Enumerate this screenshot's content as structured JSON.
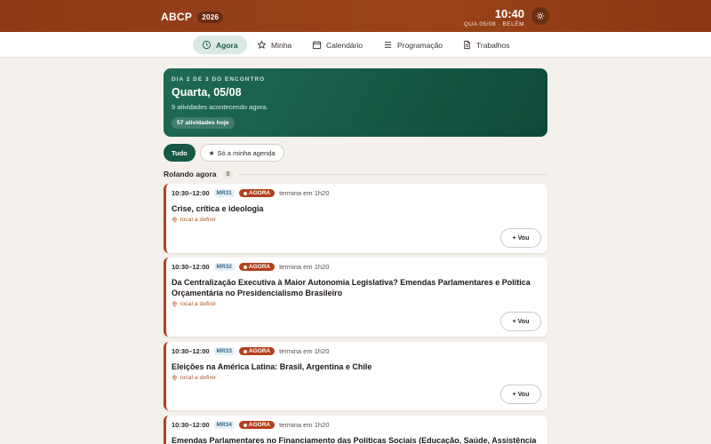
{
  "header": {
    "brand": "ABCP",
    "year": "2026",
    "time": "10:40",
    "date_place": "QUA 05/08 · BELÉM",
    "theme_icon": "sun-icon"
  },
  "tabs": [
    {
      "label": "Agora",
      "icon": "clock-icon",
      "active": true
    },
    {
      "label": "Minha",
      "icon": "star-icon"
    },
    {
      "label": "Calendário",
      "icon": "calendar-icon"
    },
    {
      "label": "Programação",
      "icon": "list-icon"
    },
    {
      "label": "Trabalhos",
      "icon": "document-icon"
    }
  ],
  "hero": {
    "kicker": "DIA 2 DE 3 DO ENCONTRO",
    "date": "Quarta, 05/08",
    "desc": "9 atividades acontecendo agora.",
    "pill": "57 atividades hoje"
  },
  "filters": {
    "all": "Tudo",
    "mine": "Só a minha agenda",
    "mine_icon": "★"
  },
  "section": {
    "title": "Rolando agora",
    "count": "9"
  },
  "now_label": "AGORA",
  "cards": [
    {
      "time": "10:30–12:00",
      "code": "MR31",
      "ends": "termina em 1h20",
      "title": "Crise, crítica e ideologia",
      "location": "local a definir",
      "button": "+ Vou"
    },
    {
      "time": "10:30–12:00",
      "code": "MR32",
      "ends": "termina em 1h20",
      "title": "Da Centralização Executiva à Maior Autonomia Legislativa? Emendas Parlamentares e Política Orçamentária no Presidencialismo Brasileiro",
      "location": "local a definir",
      "button": "+ Vou"
    },
    {
      "time": "10:30–12:00",
      "code": "MR33",
      "ends": "termina em 1h20",
      "title": "Eleições na América Latina: Brasil, Argentina e Chile",
      "location": "local a definir",
      "button": "+ Vou"
    },
    {
      "time": "10:30–12:00",
      "code": "MR34",
      "ends": "termina em 1h20",
      "title": "Emendas Parlamentares no Financiamento das Políticas Sociais (Educação, Saúde, Assistência",
      "location": "",
      "button": ""
    }
  ]
}
